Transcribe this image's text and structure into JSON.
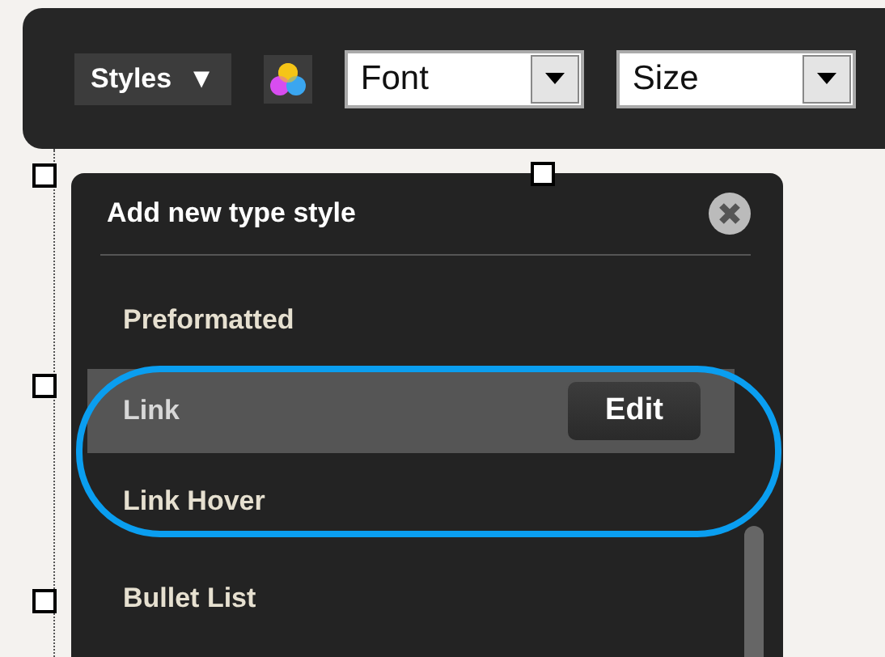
{
  "toolbar": {
    "styles_button": {
      "label": "Styles",
      "caret": "▼"
    },
    "font_select": {
      "value": "Font"
    },
    "size_select": {
      "value": "Size"
    }
  },
  "popup": {
    "title": "Add new type style",
    "items": [
      {
        "label": "Preformatted",
        "selected": false
      },
      {
        "label": "Link",
        "selected": true,
        "action": "Edit"
      },
      {
        "label": "Link Hover",
        "selected": false
      },
      {
        "label": "Bullet List",
        "selected": false
      }
    ]
  }
}
